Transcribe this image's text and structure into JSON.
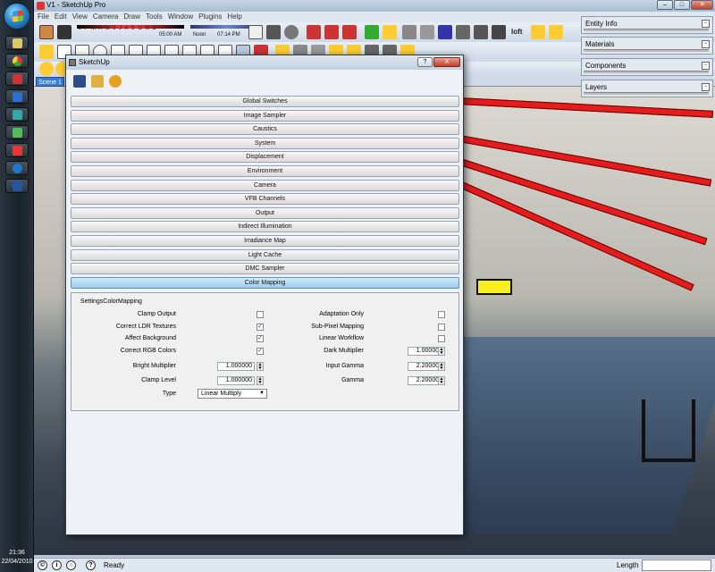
{
  "app": {
    "title": "V1 - SketchUp Pro",
    "menu": [
      "File",
      "Edit",
      "View",
      "Camera",
      "Draw",
      "Tools",
      "Window",
      "Plugins",
      "Help"
    ]
  },
  "shadow_toolbar": {
    "months": "J F M A M J J A S O N D",
    "time_start": "05:00 AM",
    "time_noon": "Noon",
    "time_end": "07:14 PM"
  },
  "toolbar": {
    "loft_label": "loft"
  },
  "scene": {
    "tab": "Scene 1"
  },
  "tray": {
    "panels": [
      "Entity Info",
      "Materials",
      "Components",
      "Layers"
    ]
  },
  "dialog": {
    "title": "SketchUp",
    "help": "?",
    "close": "X",
    "sections": [
      "Global Switches",
      "Image Sampler",
      "Caustics",
      "System",
      "Displacement",
      "Environment",
      "Camera",
      "VFB Channels",
      "Output",
      "Indirect Illumination",
      "Irradiance Map",
      "Light Cache",
      "DMC Sampler",
      "Color Mapping"
    ],
    "panel": {
      "title": "SettingsColorMapping",
      "left": [
        {
          "label": "Clamp Output",
          "checked": false
        },
        {
          "label": "Correct LDR Textures",
          "checked": true
        },
        {
          "label": "Affect Background",
          "checked": true
        },
        {
          "label": "Correct RGB Colors",
          "checked": true
        }
      ],
      "bright_multiplier": {
        "label": "Bright Multiplier",
        "value": "1.000000"
      },
      "clamp_level": {
        "label": "Clamp Level",
        "value": "1.000000"
      },
      "type": {
        "label": "Type",
        "value": "Linear Multiply"
      },
      "right": [
        {
          "label": "Adaptation Only",
          "checked": false
        },
        {
          "label": "Sub-Pixel Mapping",
          "checked": false
        },
        {
          "label": "Linear Workflow",
          "checked": false
        }
      ],
      "dark_multiplier": {
        "label": "Dark Multiplier",
        "value": "1.000000"
      },
      "input_gamma": {
        "label": "Input Gamma",
        "value": "2.200000"
      },
      "gamma": {
        "label": "Gamma",
        "value": "2.200000"
      }
    }
  },
  "status": {
    "text": "Ready",
    "length_label": "Length"
  },
  "clock": {
    "time": "21:36",
    "date": "22/04/2010"
  },
  "colors": {
    "accent": "#3a7cd0",
    "beam": "#e41c1c",
    "active_section": "#9fcbee"
  }
}
